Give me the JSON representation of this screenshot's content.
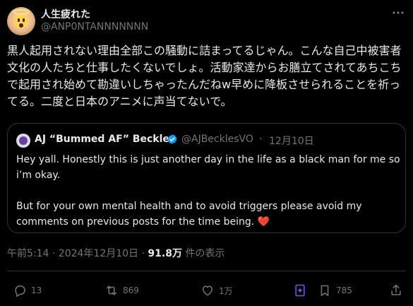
{
  "author": {
    "display_name": "人生疲れた",
    "handle": "@ANP0NTANNNNNNN"
  },
  "tweet": {
    "text": "黒人起用されない理由全部この騒動に詰まってるじゃん。こんな自己中被害者文化の人たちと仕事したくないでしょ。活動家達からお膳立てされてあちこちで起用され始めて勘違いしちゃったんだねw早めに降板させられることを祈ってる。二度と日本のアニメに声当てないで。"
  },
  "quoted": {
    "display_name": "AJ “Bummed AF” Beckles",
    "handle": "@AJBecklesVO",
    "dot": "·",
    "date": "12月10日",
    "paragraph1": "Hey yall. Honestly this is just another day in the life as a black man for me so i’m okay.",
    "paragraph2": "But for your own mental health and to avoid triggers please avoid my comments on previous posts for the time being.",
    "heart": "❤️"
  },
  "meta": {
    "time": "午前5:14 · 2024年12月10日 · ",
    "views": "91.8万",
    "views_suffix": " 件の表示"
  },
  "actions": {
    "reply_count": "13",
    "retweet_count": "869",
    "like_count": "1万",
    "bookmark_count": "785"
  },
  "colors": {
    "background": "#000000",
    "text": "#e7e9ea",
    "muted": "#71767b",
    "border": "#2f3336",
    "verified": "#1d9bf0",
    "heart": "#f91880",
    "grok": "#7856ff"
  }
}
